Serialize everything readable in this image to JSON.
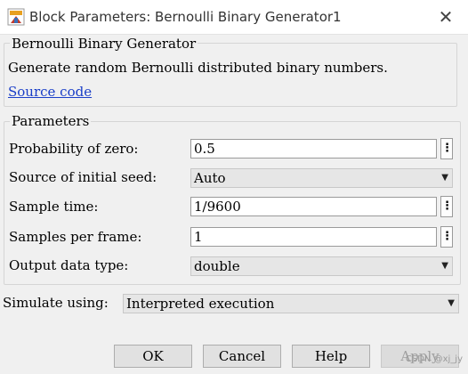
{
  "window": {
    "title": "Block Parameters: Bernoulli Binary Generator1",
    "close_glyph": "✕"
  },
  "block": {
    "name": "Bernoulli Binary Generator",
    "description": "Generate random Bernoulli distributed binary numbers.",
    "source_link": "Source code"
  },
  "parameters": {
    "legend": "Parameters",
    "probability": {
      "label": "Probability of zero:",
      "value": "0.5"
    },
    "seed": {
      "label": "Source of initial seed:",
      "value": "Auto"
    },
    "sample_time": {
      "label": "Sample time:",
      "value": "1/9600"
    },
    "samples_per_frame": {
      "label": "Samples per frame:",
      "value": "1"
    },
    "output_type": {
      "label": "Output data type:",
      "value": "double"
    }
  },
  "simulate": {
    "label": "Simulate using:",
    "value": "Interpreted execution"
  },
  "buttons": {
    "ok": "OK",
    "cancel": "Cancel",
    "help": "Help",
    "apply": "Apply"
  },
  "more_glyph": "⋮",
  "dropdown_glyph": "▼",
  "watermark": "CSDN @xj_jy",
  "icons": {
    "app": "matlab-block-icon",
    "close": "close-icon",
    "more": "vertical-ellipsis-icon",
    "dropdown": "chevron-down-icon"
  },
  "colors": {
    "link": "#1a3ec8",
    "background": "#f0f0f0"
  }
}
